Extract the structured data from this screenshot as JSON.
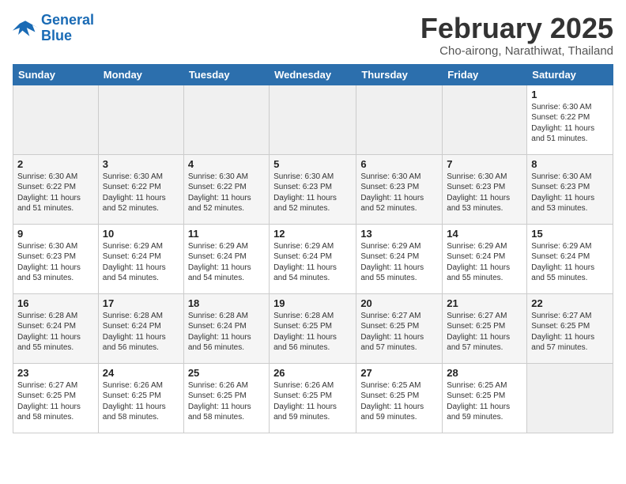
{
  "header": {
    "logo_line1": "General",
    "logo_line2": "Blue",
    "month_title": "February 2025",
    "location": "Cho-airong, Narathiwat, Thailand"
  },
  "days_of_week": [
    "Sunday",
    "Monday",
    "Tuesday",
    "Wednesday",
    "Thursday",
    "Friday",
    "Saturday"
  ],
  "weeks": [
    [
      {
        "day": "",
        "info": ""
      },
      {
        "day": "",
        "info": ""
      },
      {
        "day": "",
        "info": ""
      },
      {
        "day": "",
        "info": ""
      },
      {
        "day": "",
        "info": ""
      },
      {
        "day": "",
        "info": ""
      },
      {
        "day": "1",
        "info": "Sunrise: 6:30 AM\nSunset: 6:22 PM\nDaylight: 11 hours\nand 51 minutes."
      }
    ],
    [
      {
        "day": "2",
        "info": "Sunrise: 6:30 AM\nSunset: 6:22 PM\nDaylight: 11 hours\nand 51 minutes."
      },
      {
        "day": "3",
        "info": "Sunrise: 6:30 AM\nSunset: 6:22 PM\nDaylight: 11 hours\nand 52 minutes."
      },
      {
        "day": "4",
        "info": "Sunrise: 6:30 AM\nSunset: 6:22 PM\nDaylight: 11 hours\nand 52 minutes."
      },
      {
        "day": "5",
        "info": "Sunrise: 6:30 AM\nSunset: 6:23 PM\nDaylight: 11 hours\nand 52 minutes."
      },
      {
        "day": "6",
        "info": "Sunrise: 6:30 AM\nSunset: 6:23 PM\nDaylight: 11 hours\nand 52 minutes."
      },
      {
        "day": "7",
        "info": "Sunrise: 6:30 AM\nSunset: 6:23 PM\nDaylight: 11 hours\nand 53 minutes."
      },
      {
        "day": "8",
        "info": "Sunrise: 6:30 AM\nSunset: 6:23 PM\nDaylight: 11 hours\nand 53 minutes."
      }
    ],
    [
      {
        "day": "9",
        "info": "Sunrise: 6:30 AM\nSunset: 6:23 PM\nDaylight: 11 hours\nand 53 minutes."
      },
      {
        "day": "10",
        "info": "Sunrise: 6:29 AM\nSunset: 6:24 PM\nDaylight: 11 hours\nand 54 minutes."
      },
      {
        "day": "11",
        "info": "Sunrise: 6:29 AM\nSunset: 6:24 PM\nDaylight: 11 hours\nand 54 minutes."
      },
      {
        "day": "12",
        "info": "Sunrise: 6:29 AM\nSunset: 6:24 PM\nDaylight: 11 hours\nand 54 minutes."
      },
      {
        "day": "13",
        "info": "Sunrise: 6:29 AM\nSunset: 6:24 PM\nDaylight: 11 hours\nand 55 minutes."
      },
      {
        "day": "14",
        "info": "Sunrise: 6:29 AM\nSunset: 6:24 PM\nDaylight: 11 hours\nand 55 minutes."
      },
      {
        "day": "15",
        "info": "Sunrise: 6:29 AM\nSunset: 6:24 PM\nDaylight: 11 hours\nand 55 minutes."
      }
    ],
    [
      {
        "day": "16",
        "info": "Sunrise: 6:28 AM\nSunset: 6:24 PM\nDaylight: 11 hours\nand 55 minutes."
      },
      {
        "day": "17",
        "info": "Sunrise: 6:28 AM\nSunset: 6:24 PM\nDaylight: 11 hours\nand 56 minutes."
      },
      {
        "day": "18",
        "info": "Sunrise: 6:28 AM\nSunset: 6:24 PM\nDaylight: 11 hours\nand 56 minutes."
      },
      {
        "day": "19",
        "info": "Sunrise: 6:28 AM\nSunset: 6:25 PM\nDaylight: 11 hours\nand 56 minutes."
      },
      {
        "day": "20",
        "info": "Sunrise: 6:27 AM\nSunset: 6:25 PM\nDaylight: 11 hours\nand 57 minutes."
      },
      {
        "day": "21",
        "info": "Sunrise: 6:27 AM\nSunset: 6:25 PM\nDaylight: 11 hours\nand 57 minutes."
      },
      {
        "day": "22",
        "info": "Sunrise: 6:27 AM\nSunset: 6:25 PM\nDaylight: 11 hours\nand 57 minutes."
      }
    ],
    [
      {
        "day": "23",
        "info": "Sunrise: 6:27 AM\nSunset: 6:25 PM\nDaylight: 11 hours\nand 58 minutes."
      },
      {
        "day": "24",
        "info": "Sunrise: 6:26 AM\nSunset: 6:25 PM\nDaylight: 11 hours\nand 58 minutes."
      },
      {
        "day": "25",
        "info": "Sunrise: 6:26 AM\nSunset: 6:25 PM\nDaylight: 11 hours\nand 58 minutes."
      },
      {
        "day": "26",
        "info": "Sunrise: 6:26 AM\nSunset: 6:25 PM\nDaylight: 11 hours\nand 59 minutes."
      },
      {
        "day": "27",
        "info": "Sunrise: 6:25 AM\nSunset: 6:25 PM\nDaylight: 11 hours\nand 59 minutes."
      },
      {
        "day": "28",
        "info": "Sunrise: 6:25 AM\nSunset: 6:25 PM\nDaylight: 11 hours\nand 59 minutes."
      },
      {
        "day": "",
        "info": ""
      }
    ]
  ]
}
